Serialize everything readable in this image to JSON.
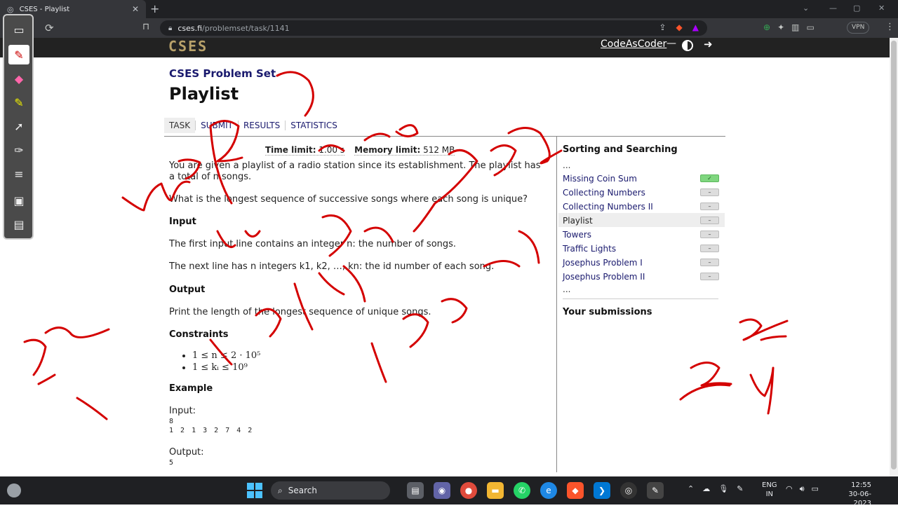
{
  "browser": {
    "tab_title": "CSES - Playlist",
    "tab_close": "✕",
    "new_tab": "+",
    "url_host": "cses.fi",
    "url_path": "/problemset/task/1141",
    "vpn_label": "VPN"
  },
  "site": {
    "logo": "CSES",
    "username": "CodeAsCoder",
    "dash": "—"
  },
  "problem": {
    "set_title": "CSES Problem Set",
    "title": "Playlist",
    "tabs": [
      "TASK",
      "SUBMIT",
      "RESULTS",
      "STATISTICS"
    ],
    "time_limit_label": "Time limit:",
    "time_limit_value": "1.00 s",
    "memory_limit_label": "Memory limit:",
    "memory_limit_value": "512 MB",
    "statement_1": "You are given a playlist of a radio station since its establishment. The playlist has a total of n songs.",
    "statement_2": "What is the longest sequence of successive songs where each song is unique?",
    "input_heading": "Input",
    "input_1": "The first input line contains an integer n: the number of songs.",
    "input_2": "The next line has n integers k1, k2, …, kn: the id number of each song.",
    "output_heading": "Output",
    "output_text": "Print the length of the longest sequence of unique songs.",
    "constraints_heading": "Constraints",
    "constraints": [
      "1 ≤ n ≤ 2 · 10⁵",
      "1 ≤ kᵢ ≤ 10⁹"
    ],
    "example_heading": "Example",
    "example_input_label": "Input:",
    "example_input_line1": "8",
    "example_input_line2": "1 2 1 3 2 7 4 2",
    "example_output_label": "Output:",
    "example_output_value": "5"
  },
  "sidebar": {
    "title": "Sorting and Searching",
    "ellipsis": "...",
    "items": [
      {
        "label": "Missing Coin Sum",
        "status": "✓"
      },
      {
        "label": "Collecting Numbers",
        "status": "–"
      },
      {
        "label": "Collecting Numbers II",
        "status": "–"
      },
      {
        "label": "Playlist",
        "status": "–"
      },
      {
        "label": "Towers",
        "status": "–"
      },
      {
        "label": "Traffic Lights",
        "status": "–"
      },
      {
        "label": "Josephus Problem I",
        "status": "–"
      },
      {
        "label": "Josephus Problem II",
        "status": "–"
      }
    ],
    "submissions_title": "Your submissions"
  },
  "taskbar": {
    "search_label": "Search",
    "lang_line1": "ENG",
    "lang_line2": "IN",
    "time": "12:55",
    "date": "30-06-2023"
  },
  "colors": {
    "ink": "#d40000",
    "link": "#1a1a6e",
    "header_bg": "#222222"
  }
}
